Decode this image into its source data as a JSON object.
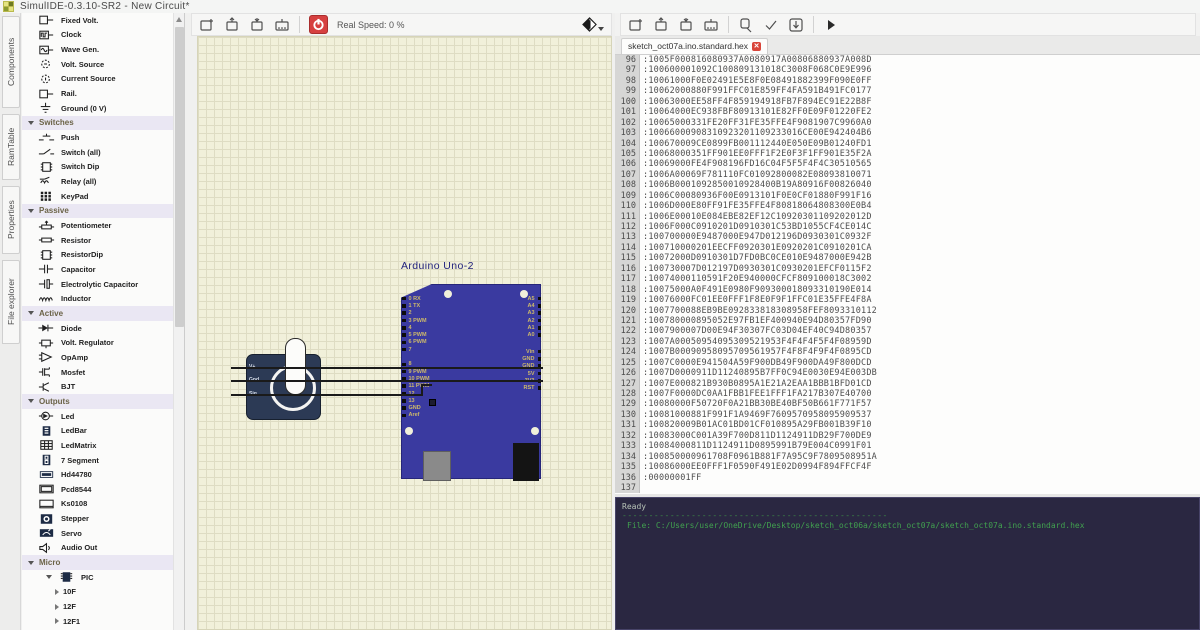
{
  "window": {
    "title": "SimulIDE-0.3.10-SR2  -  New Circuit*"
  },
  "left_tabs": [
    {
      "label": "Components"
    },
    {
      "label": "RamTable"
    },
    {
      "label": "Properties"
    },
    {
      "label": "File explorer"
    }
  ],
  "sidebar": {
    "sections": [
      {
        "header": null,
        "items": [
          {
            "label": "Fixed Volt.",
            "icon": "fixed-volt-icon"
          },
          {
            "label": "Clock",
            "icon": "clock-icon"
          },
          {
            "label": "Wave Gen.",
            "icon": "wave-gen-icon"
          },
          {
            "label": "Volt. Source",
            "icon": "volt-source-icon"
          },
          {
            "label": "Current Source",
            "icon": "current-source-icon"
          },
          {
            "label": "Rail.",
            "icon": "rail-icon"
          },
          {
            "label": "Ground (0 V)",
            "icon": "ground-icon"
          }
        ]
      },
      {
        "header": "Switches",
        "items": [
          {
            "label": "Push",
            "icon": "push-icon"
          },
          {
            "label": "Switch (all)",
            "icon": "switch-icon"
          },
          {
            "label": "Switch Dip",
            "icon": "switch-dip-icon"
          },
          {
            "label": "Relay (all)",
            "icon": "relay-icon"
          },
          {
            "label": "KeyPad",
            "icon": "keypad-icon"
          }
        ]
      },
      {
        "header": "Passive",
        "items": [
          {
            "label": "Potentiometer",
            "icon": "potentiometer-icon"
          },
          {
            "label": "Resistor",
            "icon": "resistor-icon"
          },
          {
            "label": "ResistorDip",
            "icon": "resistor-dip-icon"
          },
          {
            "label": "Capacitor",
            "icon": "capacitor-icon"
          },
          {
            "label": "Electrolytic Capacitor",
            "icon": "electrolytic-capacitor-icon"
          },
          {
            "label": "Inductor",
            "icon": "inductor-icon"
          }
        ]
      },
      {
        "header": "Active",
        "items": [
          {
            "label": "Diode",
            "icon": "diode-icon"
          },
          {
            "label": "Volt. Regulator",
            "icon": "volt-regulator-icon"
          },
          {
            "label": "OpAmp",
            "icon": "opamp-icon"
          },
          {
            "label": "Mosfet",
            "icon": "mosfet-icon"
          },
          {
            "label": "BJT",
            "icon": "bjt-icon"
          }
        ]
      },
      {
        "header": "Outputs",
        "items": [
          {
            "label": "Led",
            "icon": "led-icon"
          },
          {
            "label": "LedBar",
            "icon": "ledbar-icon"
          },
          {
            "label": "LedMatrix",
            "icon": "ledmatrix-icon"
          },
          {
            "label": "7 Segment",
            "icon": "seven-segment-icon"
          },
          {
            "label": "Hd44780",
            "icon": "hd44780-icon"
          },
          {
            "label": "Pcd8544",
            "icon": "pcd8544-icon"
          },
          {
            "label": "Ks0108",
            "icon": "ks0108-icon"
          },
          {
            "label": "Stepper",
            "icon": "stepper-icon"
          },
          {
            "label": "Servo",
            "icon": "servo-icon"
          },
          {
            "label": "Audio Out",
            "icon": "audio-out-icon"
          }
        ]
      },
      {
        "header": "Micro",
        "items": [
          {
            "label": "PIC",
            "icon": "pic-chip-icon",
            "tree": "root",
            "chevron": "down"
          },
          {
            "label": "10F",
            "tree": "sub",
            "chevron": "right"
          },
          {
            "label": "12F",
            "tree": "sub",
            "chevron": "right"
          },
          {
            "label": "12F1",
            "tree": "sub",
            "chevron": "right"
          }
        ]
      }
    ]
  },
  "circuit_toolbar": {
    "real_speed": "Real Speed: 0 %"
  },
  "canvas": {
    "arduino": {
      "title": "Arduino Uno-2",
      "left_pins": [
        "0 RX",
        "1 TX",
        "2",
        "3 PWM",
        "4",
        "5 PWM",
        "6 PWM",
        "7",
        "",
        "8",
        "9 PWM",
        "10 PWM",
        "11 PWM",
        "12",
        "13",
        "GND",
        "Aref"
      ],
      "right_pins_top": [
        "A5",
        "A4",
        "A3",
        "A2",
        "A1",
        "A0"
      ],
      "right_pins_bottom": [
        "Vin",
        "GND",
        "GND",
        "5V",
        "3V3",
        "RST"
      ]
    },
    "servo": {
      "pins": [
        "V+",
        "Gnd",
        "Sig"
      ]
    },
    "colors": {
      "board": "#3a3aa0",
      "grid_bg": "#f1f0da",
      "wire": "#1a1a1a",
      "servo_body": "#2c3a55"
    }
  },
  "editor": {
    "tab": "sketch_oct07a.ino.standard.hex",
    "first_line": 96,
    "lines": [
      ":1005F000816080937A0080917A00806880937A008D",
      ":100600001092C100809131018C3008F068C0E9E996",
      ":10061000F0E02491E5E8F0E08491882399F090E0FF",
      ":10062000880F991FFC01E859FF4FA591B491FC0177",
      ":10063000EE58FF4F859194918FB7F894EC91E22B8F",
      ":10064000EC938FBF80913101E82FF0E09F01220FE2",
      ":10065000331FE20FF31FE35FFE4F9081907C9960A0",
      ":10066000908310923201109233016CE00E942404B6",
      ":100670009CE0899FB001112440E050E09B01240FD1",
      ":10068000351FF901EE0FFF1F2E0F3F1FF901E35F2A",
      ":10069000FE4F908196FD16C04F5F5F4F4C30510565",
      ":1006A00069F781110FC01092800082E08093810071",
      ":1006B0001092850010928400B19A80916F00826040",
      ":1006C00080936F00E0913101F0E0CF01880F991F16",
      ":1006D000E80FF91FE35FFE4F80818064808300E0B4",
      ":1006E00010E084EBE82EF12C10920301109202012D",
      ":1006F000C0910201D0910301C53BD1055CF4CE014C",
      ":100700000E9487000E947D012196D0930301C0932F",
      ":100710000201EECFF0920301E0920201C0910201CA",
      ":10072000D0910301D7FD0BC0CE010E9487000E942B",
      ":100730007D012197D0930301C0930201EFCF0115F2",
      ":10074000110591F20E940000CFCF809100018C3002",
      ":10075000A0F491E0980F909300018093310190E014",
      ":10076000FC01EE0FFF1F8E0F9F1FFC01E35FFE4F8A",
      ":1007700088EB9BE092833818308958FEF8093310112",
      ":100780000895052E97FB1EF400940E94D80357FD90",
      ":1007900007D00E94F30307FC03D04EF40C94D80357",
      ":1007A00050954095309521953F4F4F4F5F4F08959D",
      ":1007B00090958095709561957F4F8F4F9F4F0895CD",
      ":1007C0000E941504A59F900DB49F900DA49F800DCD",
      ":1007D0000911D11240895B7FF0C94E0030E94E003DB",
      ":1007E000821B930B0895A1E21A2EAA1BBB1BFD01CD",
      ":1007F0000DC0AA1FBB1FEE1FFF1FA217B307E40700",
      ":10080000F50720F0A21BB30BE40BF50B661F771F57",
      ":10081000881F991F1A9469F7609570958095909537",
      ":100820009B01AC01BD01CF010895A29FB001B39F10",
      ":10083000C001A39F700D811D1124911DB29F700DE9",
      ":10084000811D1124911D0895991B79E004C0991F01",
      ":100850000961708F0961B881F7A95C9F7809508951A",
      ":10086000EE0FFF1F0590F491E02D0994F894FFCF4F",
      ":00000001FF",
      ""
    ]
  },
  "console": {
    "status": "Ready",
    "separator": "--------------------------------------------------",
    "file_line": "File: C:/Users/user/OneDrive/Desktop/sketch_oct06a/sketch_oct07a/sketch_oct07a.ino.standard.hex"
  }
}
